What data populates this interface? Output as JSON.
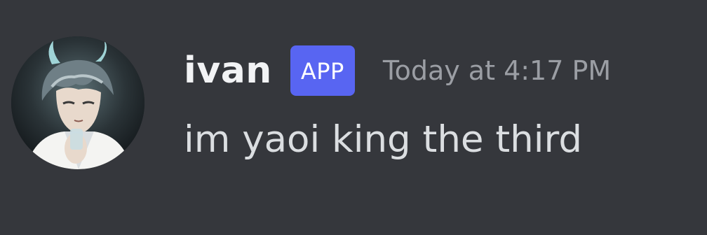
{
  "message": {
    "author": {
      "username": "ivan",
      "badge": "APP",
      "avatar_icon": "anime-character-avatar-icon"
    },
    "timestamp": "Today at 4:17 PM",
    "content": "im yaoi king the third"
  },
  "colors": {
    "background": "#35373c",
    "username": "#f2f3f5",
    "badge_bg": "#5865f2",
    "timestamp": "#9b9ea4",
    "content": "#dbdee1"
  }
}
